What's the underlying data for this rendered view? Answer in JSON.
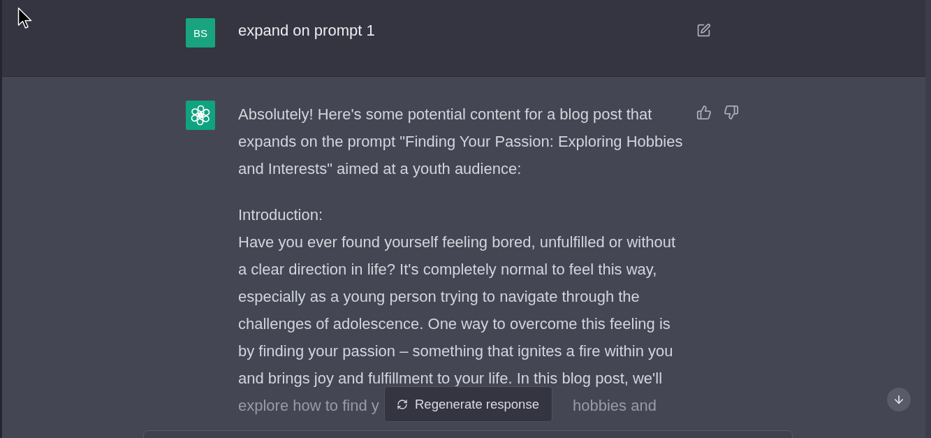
{
  "user_message": {
    "avatar_initials": "BS",
    "text": "expand on prompt 1"
  },
  "assistant_message": {
    "blocks": [
      {
        "kind": "paragraph",
        "text": "Absolutely! Here's some potential content for a blog post that expands on the prompt \"Finding Your Passion: Exploring Hobbies and Interests\" aimed at a youth audience:"
      },
      {
        "kind": "label",
        "text": "Introduction:"
      },
      {
        "kind": "paragraph_continued",
        "text": "Have you ever found yourself feeling bored, unfulfilled or without a clear direction in life? It's completely normal to feel this way, especially as a young person trying to navigate through the challenges of adolescence. One way to overcome this feeling is by finding your passion – something that ignites a fire within you and brings joy and fulfillment to your life. In this blog post, we'll"
      },
      {
        "kind": "faded_line",
        "parts": [
          "explore how to find y",
          "hobbies and"
        ]
      }
    ]
  },
  "regenerate_button": {
    "label": "Regenerate response"
  }
}
